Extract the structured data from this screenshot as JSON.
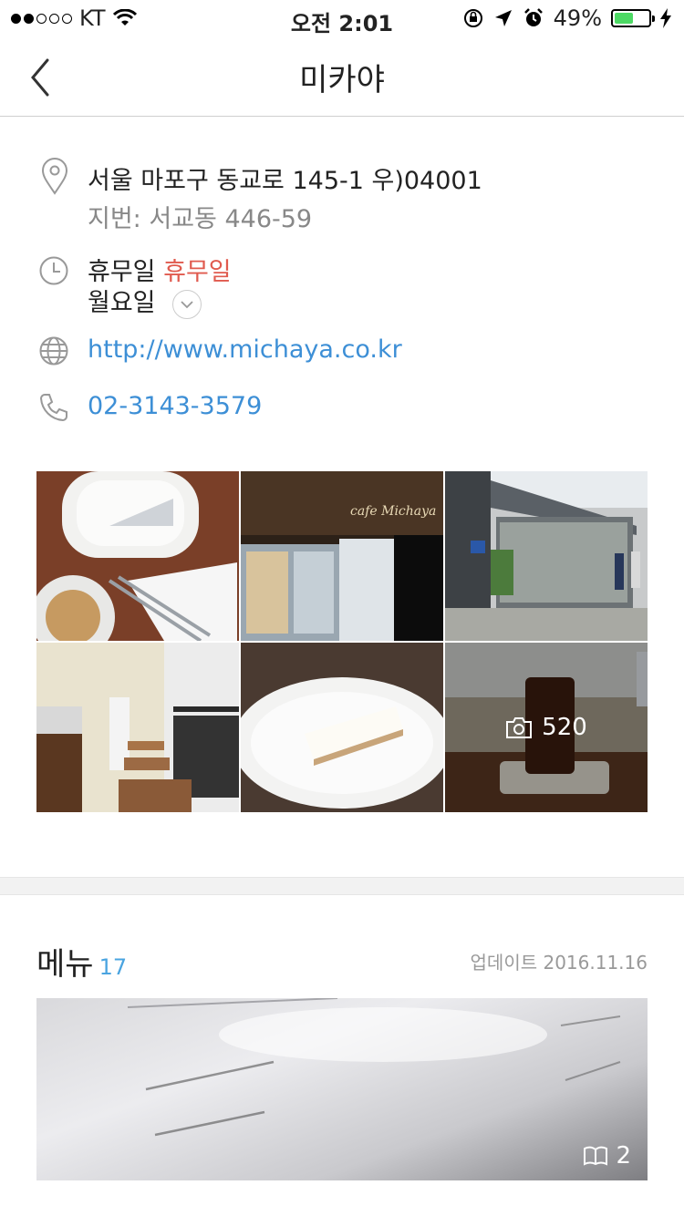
{
  "status": {
    "carrier": "KT",
    "time": "오전 2:01",
    "battery": "49%"
  },
  "nav": {
    "title": "미카야"
  },
  "info": {
    "address": "서울 마포구 동교로 145-1 우)04001",
    "address_sub": "지번: 서교동 446-59",
    "hours_label": "휴무일",
    "hours_value": "휴무일",
    "hours_day": "월요일",
    "website": "http://www.michaya.co.kr",
    "phone": "02-3143-3579"
  },
  "photos": {
    "count": "520"
  },
  "menu": {
    "title": "메뉴",
    "count": "17",
    "updated": "업데이트 2016.11.16",
    "image_count": "2"
  }
}
